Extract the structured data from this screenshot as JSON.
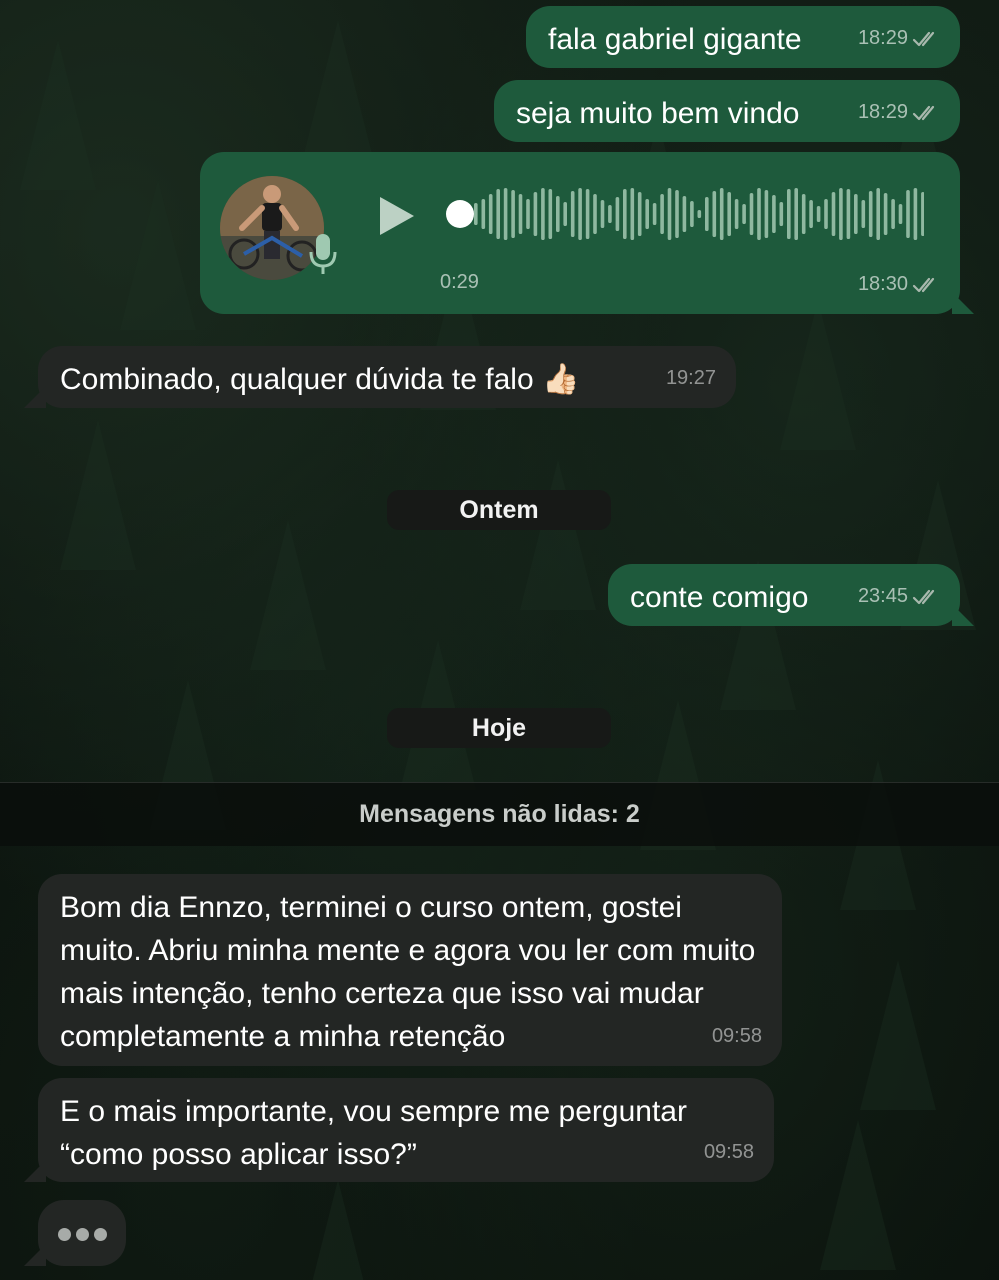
{
  "messages": [
    {
      "id": "m1",
      "direction": "outgoing",
      "text": "fala gabriel gigante",
      "time": "18:29",
      "status": "read"
    },
    {
      "id": "m2",
      "direction": "outgoing",
      "text": "seja muito bem vindo",
      "time": "18:29",
      "status": "read"
    },
    {
      "id": "m3",
      "direction": "outgoing",
      "type": "voice",
      "duration": "0:29",
      "time": "18:30",
      "status": "read",
      "progress": 0
    },
    {
      "id": "m4",
      "direction": "incoming",
      "text": "Combinado, qualquer dúvida te falo",
      "emoji": "👍🏻",
      "time": "19:27"
    },
    {
      "id": "m5",
      "direction": "outgoing",
      "text": "conte comigo",
      "time": "23:45",
      "status": "read"
    },
    {
      "id": "m6",
      "direction": "incoming",
      "text": "Bom dia Ennzo, terminei o curso ontem, gostei muito. Abriu minha mente e agora vou ler com muito mais intenção, tenho certeza que isso vai mudar completamente a minha retenção",
      "time": "09:58"
    },
    {
      "id": "m7",
      "direction": "incoming",
      "text": "E o mais importante, vou sempre me perguntar “como posso aplicar isso?”",
      "time": "09:58"
    }
  ],
  "date_separators": {
    "yesterday": "Ontem",
    "today": "Hoje"
  },
  "unread_banner": "Mensagens não lidas: 2",
  "typing_indicator": true,
  "colors": {
    "outgoing_bubble": "#1e5a3c",
    "incoming_bubble": "#232624",
    "wallpaper": "#0d120e",
    "read_ticks": "#a8b8ad"
  },
  "icons": {
    "read_status": "double-check-icon",
    "play": "play-icon",
    "mic": "microphone-icon",
    "avatar": "contact-avatar"
  }
}
